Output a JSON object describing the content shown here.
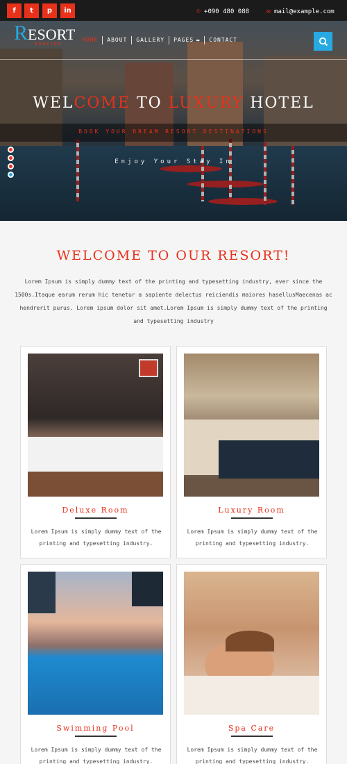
{
  "topbar": {
    "social": [
      {
        "name": "facebook",
        "glyph": "f"
      },
      {
        "name": "twitter",
        "glyph": "t"
      },
      {
        "name": "pinterest",
        "glyph": "p"
      },
      {
        "name": "linkedin",
        "glyph": "in"
      }
    ],
    "phone": "+090 480 088",
    "email": "mail@example.com"
  },
  "header": {
    "logo_initial": "R",
    "logo_rest": "ESORT",
    "logo_sub": "BOOKING",
    "nav": [
      "HOME",
      "ABOUT",
      "GALLERY",
      "PAGES",
      "CONTACT"
    ]
  },
  "hero": {
    "title_part1": "WEL",
    "title_part2": "COME",
    "title_part3": " TO ",
    "title_part4": "LUXURY",
    "title_part5": " HOTEL",
    "subtitle": "BOOK YOUR DREAM RESORT DESTINATIONS",
    "tagline": "Enjoy Your Stay In",
    "slides": 4,
    "active_slide": 4
  },
  "welcome": {
    "title": "WELCOME TO OUR RESORT!",
    "text": "Lorem Ipsum is simply dummy text of the printing and typesetting industry, ever since the 1500s.Itaque earum rerum hic tenetur a sapiente delectus reiciendis maiores hasellusMaecenas ac hendrerit purus. Lorem ipsum dolor sit amet.Lorem Ipsum is simply dummy text of the printing and typesetting industry"
  },
  "rooms": [
    {
      "title": "Deluxe Room",
      "desc": "Lorem Ipsum is simply dummy text of the printing and typesetting industry."
    },
    {
      "title": "Luxury Room",
      "desc": "Lorem Ipsum is simply dummy text of the printing and typesetting industry."
    },
    {
      "title": "Swimming Pool",
      "desc": "Lorem Ipsum is simply dummy text of the printing and typesetting industry."
    },
    {
      "title": "Spa Care",
      "desc": "Lorem Ipsum is simply dummy text of the printing and typesetting industry."
    }
  ],
  "colors": {
    "accent": "#e8311a",
    "blue": "#27a9e1",
    "topbar": "#1b1b1b"
  }
}
